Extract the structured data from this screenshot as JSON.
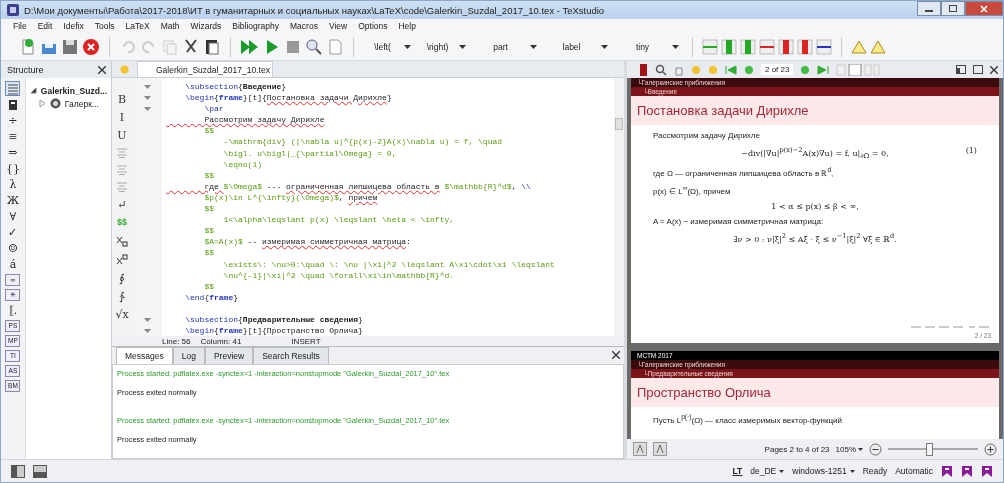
{
  "window": {
    "title": "D:\\Мои документы\\Работа\\2017-2018\\ИТ в гуманитарных и социальных науках\\LaTeX\\code\\Galerkin_Suzdal_2017_10.tex - TeXstudio"
  },
  "menu": [
    "File",
    "Edit",
    "Idefix",
    "Tools",
    "LaTeX",
    "Math",
    "Wizards",
    "Bibliography",
    "Macros",
    "View",
    "Options",
    "Help"
  ],
  "toolbar": {
    "combos": [
      "\\left(",
      "\\right)",
      "part",
      "label",
      "tiny"
    ]
  },
  "structure": {
    "title": "Structure",
    "symbol_tabs": [
      {
        "kind": "list",
        "selected": true
      },
      {
        "kind": "book",
        "selected": false
      },
      {
        "kind": "glyph",
        "label": "÷",
        "selected": false
      },
      {
        "kind": "glyph",
        "label": "≡",
        "selected": false
      },
      {
        "kind": "glyph",
        "label": "⇒",
        "selected": false
      },
      {
        "kind": "glyph",
        "label": "{}",
        "selected": false
      },
      {
        "kind": "glyph",
        "label": "λ",
        "selected": false
      },
      {
        "kind": "glyph",
        "label": "Ж",
        "selected": false
      },
      {
        "kind": "glyph",
        "label": "∀",
        "selected": false
      },
      {
        "kind": "glyph",
        "label": "✓",
        "selected": false
      },
      {
        "kind": "glyph",
        "label": "☺",
        "selected": false
      },
      {
        "kind": "glyph",
        "label": "á",
        "selected": false
      },
      {
        "kind": "boxed",
        "label": "∞",
        "selected": false
      },
      {
        "kind": "boxed",
        "label": "✳",
        "selected": false
      },
      {
        "kind": "glyph",
        "label": "⟦.",
        "selected": false
      },
      {
        "kind": "boxed",
        "label": "PS",
        "selected": false
      },
      {
        "kind": "boxed",
        "label": "MP",
        "selected": false
      },
      {
        "kind": "boxed",
        "label": "TI",
        "selected": false
      },
      {
        "kind": "boxed",
        "label": "AS",
        "selected": false
      },
      {
        "kind": "boxed",
        "label": "BM",
        "selected": false
      }
    ],
    "tree": [
      {
        "label": "Galerkin_Suzd...",
        "expanded": true,
        "children": [
          {
            "label": "Галерк...",
            "expanded": false
          }
        ]
      }
    ]
  },
  "editor": {
    "tab": "Galerkin_Suzdal_2017_10.tex",
    "format_strip": [
      {
        "kind": "glyph",
        "label": "B"
      },
      {
        "kind": "glyph",
        "label": "I"
      },
      {
        "kind": "glyph",
        "label": "U"
      },
      {
        "kind": "align"
      },
      {
        "kind": "align"
      },
      {
        "kind": "align"
      },
      {
        "kind": "glyph",
        "label": "↵"
      },
      {
        "kind": "math",
        "label": "$$"
      },
      {
        "kind": "sub"
      },
      {
        "kind": "sup"
      },
      {
        "kind": "glyph",
        "label": "∮"
      },
      {
        "kind": "glyph",
        "label": "∱"
      },
      {
        "kind": "glyph",
        "label": "√x"
      }
    ],
    "lines": [
      {
        "fold": true,
        "tokens": [
          {
            "kind": "cmd",
            "text": "    \\subsection"
          },
          {
            "kind": "plain",
            "text": "{"
          },
          {
            "kind": "key",
            "text": "Введение"
          },
          {
            "kind": "plain",
            "text": "}"
          }
        ]
      },
      {
        "fold": true,
        "tokens": [
          {
            "kind": "cmd",
            "text": "    \\begin"
          },
          {
            "kind": "plain",
            "text": "{"
          },
          {
            "kind": "env",
            "text": "frame"
          },
          {
            "kind": "plain",
            "text": "}[t]{"
          },
          {
            "kind": "spell",
            "text": "Постановка задачи Дирихле"
          },
          {
            "kind": "plain",
            "text": "}"
          }
        ]
      },
      {
        "fold": true,
        "tokens": [
          {
            "kind": "cmd",
            "text": "        \\par"
          }
        ]
      },
      {
        "fold": false,
        "tokens": [
          {
            "kind": "spell",
            "text": "        Рассмотрим задачу Дирихле"
          }
        ]
      },
      {
        "fold": false,
        "tokens": [
          {
            "kind": "math",
            "text": "        $$"
          }
        ]
      },
      {
        "fold": false,
        "tokens": [
          {
            "kind": "math",
            "text": "            -\\mathrm{div} (|\\nabla u|^{p(x)-2}A(x)\\nabla u) = f, \\quad"
          }
        ]
      },
      {
        "fold": false,
        "tokens": [
          {
            "kind": "math",
            "text": "            \\bigl. u\\bigl|_{\\partial\\Omega} = 0,"
          }
        ]
      },
      {
        "fold": false,
        "tokens": [
          {
            "kind": "math",
            "text": "            \\eqno(1)"
          }
        ]
      },
      {
        "fold": false,
        "tokens": [
          {
            "kind": "math",
            "text": "        $$"
          }
        ]
      },
      {
        "fold": false,
        "tokens": [
          {
            "kind": "spell",
            "text": "        где "
          },
          {
            "kind": "math",
            "text": "$\\Omega$"
          },
          {
            "kind": "plain",
            "text": " --- "
          },
          {
            "kind": "spell",
            "text": "ограниченная липшицева область в"
          },
          {
            "kind": "math",
            "text": " $\\mathbb{R}^d$"
          },
          {
            "kind": "plain",
            "text": ", "
          },
          {
            "kind": "cmd",
            "text": "\\\\"
          }
        ]
      },
      {
        "fold": false,
        "tokens": [
          {
            "kind": "math",
            "text": "        $p(x)\\in L^{\\infty}(\\Omega)$"
          },
          {
            "kind": "plain",
            "text": ", "
          },
          {
            "kind": "spell",
            "text": "причем"
          }
        ]
      },
      {
        "fold": false,
        "tokens": [
          {
            "kind": "math",
            "text": "        $$"
          }
        ]
      },
      {
        "fold": false,
        "tokens": [
          {
            "kind": "math",
            "text": "            1<\\alpha\\leqslant p(x) \\leqslant \\beta < \\infty,"
          }
        ]
      },
      {
        "fold": false,
        "tokens": [
          {
            "kind": "math",
            "text": "        $$"
          }
        ]
      },
      {
        "fold": false,
        "tokens": [
          {
            "kind": "math",
            "text": "        $A=A(x)$"
          },
          {
            "kind": "plain",
            "text": " -- "
          },
          {
            "kind": "spell",
            "text": "измеримая симметричная матрица"
          },
          {
            "kind": "plain",
            "text": ":"
          }
        ]
      },
      {
        "fold": false,
        "tokens": [
          {
            "kind": "math",
            "text": "        $$"
          }
        ]
      },
      {
        "fold": false,
        "tokens": [
          {
            "kind": "math",
            "text": "            \\exists\\: \\nu>0:\\quad \\: \\nu |\\xi|^2 \\leqslant A\\xi\\cdot\\xi \\leqslant"
          }
        ]
      },
      {
        "fold": false,
        "tokens": [
          {
            "kind": "math",
            "text": "            \\nu^{-1}|\\xi|^2 \\quad \\forall\\xi\\in\\mathbb{R}^d."
          }
        ]
      },
      {
        "fold": false,
        "tokens": [
          {
            "kind": "math",
            "text": "        $$"
          }
        ]
      },
      {
        "fold": false,
        "tokens": [
          {
            "kind": "cmd",
            "text": "    \\end"
          },
          {
            "kind": "plain",
            "text": "{"
          },
          {
            "kind": "env",
            "text": "frame"
          },
          {
            "kind": "plain",
            "text": "}"
          }
        ]
      },
      {
        "fold": false
      },
      {
        "fold": true,
        "tokens": [
          {
            "kind": "cmd",
            "text": "    \\subsection"
          },
          {
            "kind": "plain",
            "text": "{"
          },
          {
            "kind": "key",
            "text": "Предварительные сведения"
          },
          {
            "kind": "plain",
            "text": "}"
          }
        ]
      },
      {
        "fold": true,
        "tokens": [
          {
            "kind": "cmd",
            "text": "    \\begin"
          },
          {
            "kind": "plain",
            "text": "{"
          },
          {
            "kind": "env",
            "text": "frame"
          },
          {
            "kind": "plain",
            "text": "}[t]{Пространство Орлича}"
          }
        ]
      }
    ],
    "status": {
      "line": "Line: 56",
      "column": "Column: 41",
      "mode": "INSERT"
    }
  },
  "messages": {
    "tabs": [
      {
        "label": "Messages",
        "selected": true
      },
      {
        "label": "Log",
        "selected": false
      },
      {
        "label": "Preview",
        "selected": false
      },
      {
        "label": "Search Results",
        "selected": false
      }
    ],
    "lines": [
      {
        "kind": "start",
        "text": "Process started: pdflatex.exe -synctex=1 -interaction=nonstopmode \"Galerkin_Suzdal_2017_10\".tex"
      },
      {
        "kind": "exit",
        "text": "Process exited normally"
      },
      {
        "kind": "start",
        "text": "Process started: pdflatex.exe -synctex=1 -interaction=nonstopmode \"Galerkin_Suzdal_2017_10\".tex"
      },
      {
        "kind": "exit",
        "text": "Process exited normally"
      }
    ]
  },
  "preview": {
    "page_field": "2 of 23",
    "slides": [
      {
        "header": [
          "└Галеркинские приближения",
          "└Введение"
        ],
        "title": "Постановка задачи Дирихле",
        "body": [
          {
            "kind": "text",
            "text": "Рассмотрим задачу Дирихле"
          },
          {
            "kind": "equation",
            "text": "−div(|∇u|$^{p(x)−2}$A(x)∇u) = f,    u|$_{∂Ω}$ = 0,",
            "number": "(1)"
          },
          {
            "kind": "text",
            "text": "где Ω — ограниченная липшицева область в ℝ$^{d}$,"
          },
          {
            "kind": "text",
            "text": "p(x) ∈ L$^{∞}$(Ω), причем"
          },
          {
            "kind": "equation",
            "text": "1 < α ≤ p(x) ≤ β < ∞,"
          },
          {
            "kind": "text",
            "text": "A = A(x) − измеримая симметричная матрица:"
          },
          {
            "kind": "equation",
            "text": "∃ν > 0 :    ν|ξ|$^{2}$ ≤ Aξ · ξ ≤ ν$^{−1}$|ξ|$^{2}$    ∀ξ ∈ ℝ$^{d}$."
          }
        ],
        "page": "2 / 23"
      },
      {
        "conference": "МСТМ 2017",
        "header": [
          "└Галеркинские приближения",
          "└Предварительные сведения"
        ],
        "title": "Пространство Орлича",
        "body": [
          {
            "kind": "text",
            "text": "Пусть L$^{p(·)}$(Ω) — класс измеримых вектор-функций"
          }
        ]
      }
    ],
    "pages": "Pages 2 to 4 of 23",
    "zoom": "105%",
    "zoom_slider": {
      "level": 0.45
    }
  },
  "status_bar": {
    "checker": "LT",
    "language": "de_DE",
    "encoding": "windows-1251",
    "state": "Ready",
    "mode": "Automatic"
  }
}
